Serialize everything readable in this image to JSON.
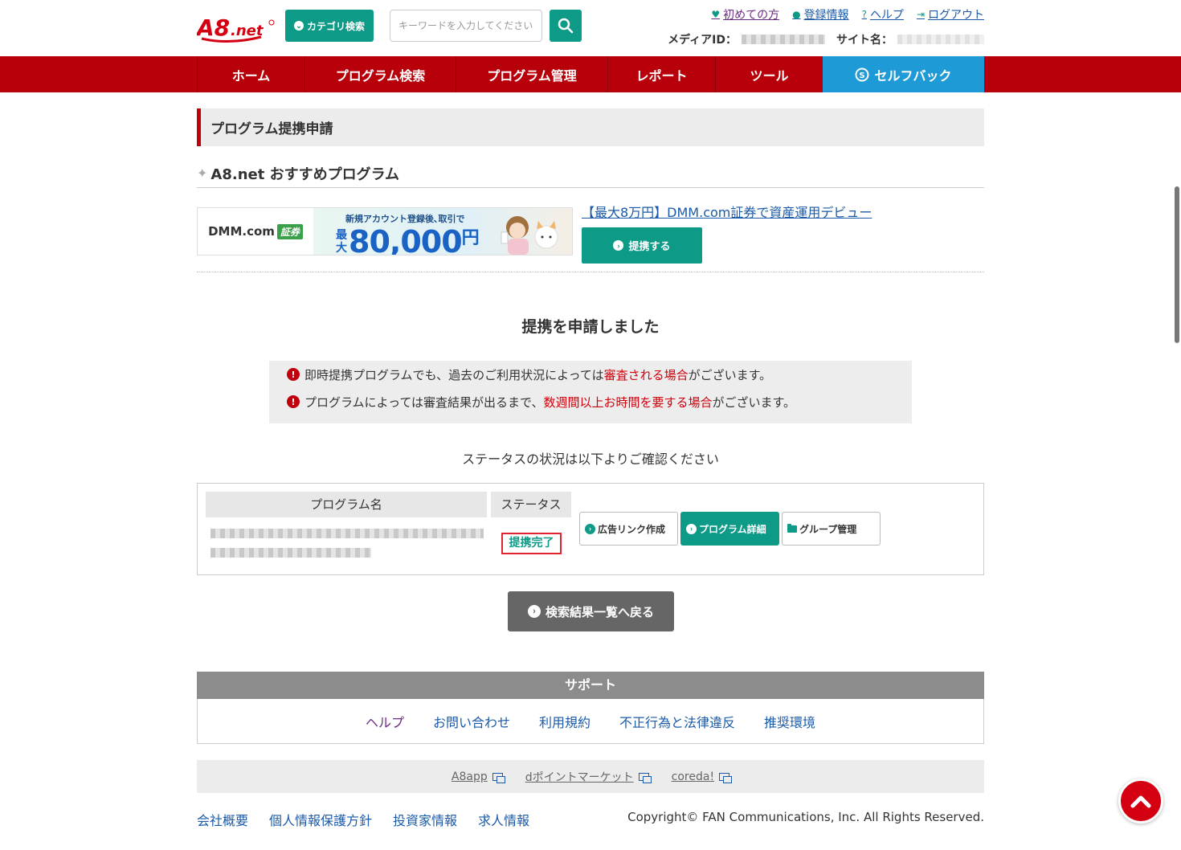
{
  "header": {
    "logo_text": "A8.net",
    "category_button": "カテゴリ検索",
    "search_placeholder": "キーワードを入力してください",
    "top_links": [
      "初めての方",
      "登録情報",
      "ヘルプ",
      "ログアウト"
    ],
    "media_id_label": "メディアID：",
    "site_name_label": "サイト名："
  },
  "nav": {
    "items": [
      "ホーム",
      "プログラム検索",
      "プログラム管理",
      "レポート",
      "ツール"
    ],
    "selfback": "セルフバック"
  },
  "page_title": "プログラム提携申請",
  "recommend": {
    "heading": "A8.net おすすめプログラム",
    "banner_brand": "DMM.com",
    "banner_tag": "証券",
    "banner_sub": "新規アカウント登録後､取引で",
    "banner_max": "最大",
    "banner_amount": "80,000",
    "banner_yen": "円",
    "link_text": "【最大8万円】DMM.com証券で資産運用デビュー",
    "apply_button": "提携する"
  },
  "result": {
    "title": "提携を申請しました",
    "notice1_pre": "即時提携プログラムでも、過去のご利用状況によっては",
    "notice1_red": "審査される場合",
    "notice1_post": "がございます。",
    "notice2_pre": "プログラムによっては審査結果が出るまで、",
    "notice2_red": "数週間以上お時間を要する場合",
    "notice2_post": "がございます。",
    "status_guide": "ステータスの状況は以下よりご確認ください"
  },
  "status_table": {
    "col_name": "プログラム名",
    "col_status": "ステータス",
    "status_value": "提携完了",
    "btn_adlink": "広告リンク作成",
    "btn_detail": "プログラム詳細",
    "btn_group": "グループ管理"
  },
  "back_button": "検索結果一覧へ戻る",
  "support": {
    "heading": "サポート",
    "links": [
      "ヘルプ",
      "お問い合わせ",
      "利用規約",
      "不正行為と法律違反",
      "推奨環境"
    ]
  },
  "partners": [
    "A8app",
    "dポイントマーケット",
    "coreda!"
  ],
  "footer": {
    "links": [
      "会社概要",
      "個人情報保護方針",
      "投資家情報",
      "求人情報"
    ],
    "copyright": "Copyright© FAN Communications, Inc. All Rights Reserved."
  },
  "colors": {
    "brand_red": "#b8000b",
    "accent_green": "#0d9b87",
    "selfback_blue": "#1e9bd7"
  }
}
